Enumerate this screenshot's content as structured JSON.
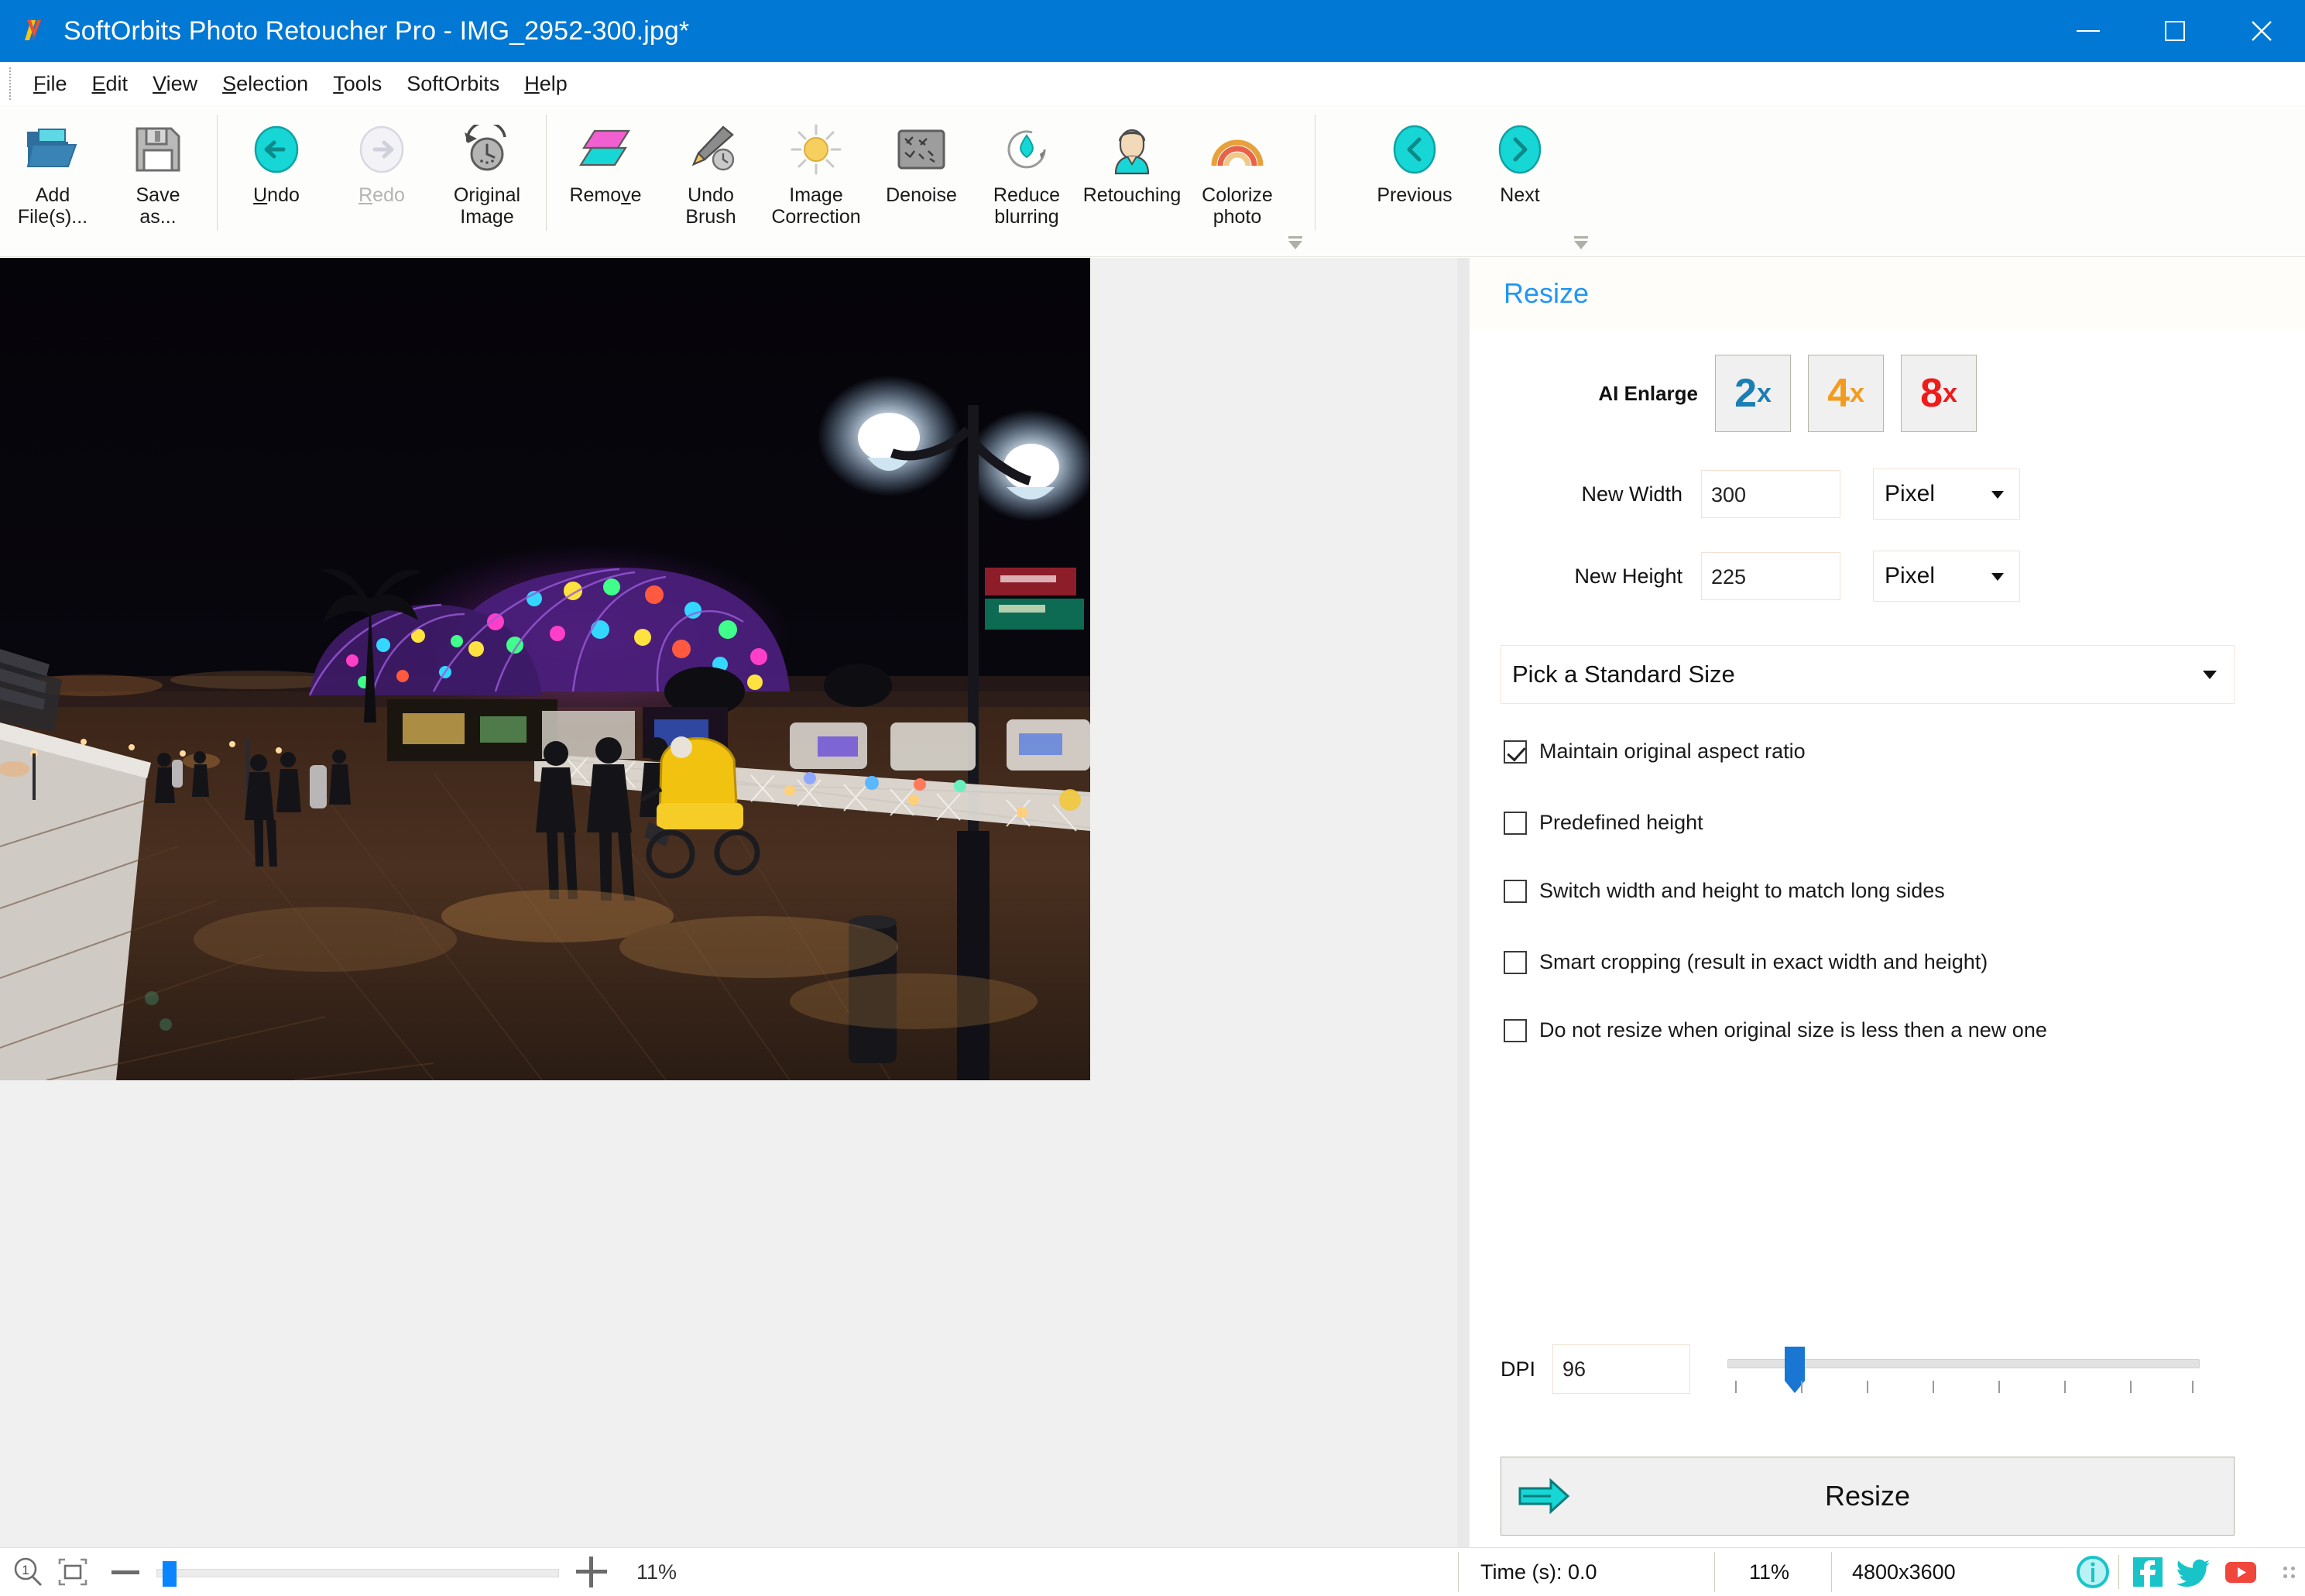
{
  "window": {
    "title": "SoftOrbits Photo Retoucher Pro - IMG_2952-300.jpg*",
    "app_icon": "softorbits-logo-icon",
    "titlebar_color": "#0078d4",
    "controls": {
      "minimize": "minimize-icon",
      "maximize": "maximize-icon",
      "close": "close-icon"
    }
  },
  "menubar": {
    "items": [
      {
        "label": "File",
        "accel": "F"
      },
      {
        "label": "Edit",
        "accel": "E"
      },
      {
        "label": "View",
        "accel": "V"
      },
      {
        "label": "Selection",
        "accel": "S"
      },
      {
        "label": "Tools",
        "accel": "T"
      },
      {
        "label": "SoftOrbits",
        "accel": ""
      },
      {
        "label": "Help",
        "accel": "H"
      }
    ]
  },
  "toolbar": {
    "groups": [
      {
        "name": "file",
        "buttons": [
          {
            "label": "Add\nFile(s)...",
            "icon": "open-folder-icon",
            "disabled": false
          },
          {
            "label": "Save\nas...",
            "icon": "floppy-disk-save-icon",
            "disabled": false
          }
        ]
      },
      {
        "name": "history",
        "buttons": [
          {
            "label": "Undo",
            "icon": "undo-arrow-circle-icon",
            "disabled": false
          },
          {
            "label": "Redo",
            "icon": "redo-arrow-circle-icon",
            "disabled": true
          },
          {
            "label": "Original\nImage",
            "icon": "clock-revert-icon",
            "disabled": false
          }
        ]
      },
      {
        "name": "tools",
        "buttons": [
          {
            "label": "Remove",
            "icon": "eraser-icon",
            "disabled": false
          },
          {
            "label": "Undo\nBrush",
            "icon": "undo-brush-icon",
            "disabled": false
          },
          {
            "label": "Image\nCorrection",
            "icon": "sun-brightness-icon",
            "disabled": false
          },
          {
            "label": "Denoise",
            "icon": "denoise-grain-icon",
            "disabled": false
          },
          {
            "label": "Reduce\nblurring",
            "icon": "droplet-sharpen-icon",
            "disabled": false
          },
          {
            "label": "Retouching",
            "icon": "person-portrait-icon",
            "disabled": false
          },
          {
            "label": "Colorize\nphoto",
            "icon": "rainbow-icon",
            "disabled": false
          }
        ],
        "overflow": "toolbar-overflow-icon"
      },
      {
        "name": "navigation",
        "buttons": [
          {
            "label": "Previous",
            "icon": "chevron-left-circle-icon",
            "disabled": false
          },
          {
            "label": "Next",
            "icon": "chevron-right-circle-icon",
            "disabled": false
          }
        ],
        "overflow": "toolbar-overflow-icon"
      }
    ]
  },
  "canvas": {
    "image_alt": "night-boardwalk-photo",
    "background": "#f0f0f0"
  },
  "panel": {
    "title": "Resize",
    "title_color": "#2196f3",
    "ai_enlarge": {
      "label": "AI Enlarge",
      "options": [
        {
          "label": "2",
          "suffix": "x",
          "color": "#1a7fb5"
        },
        {
          "label": "4",
          "suffix": "x",
          "color": "#f29b1d"
        },
        {
          "label": "8",
          "suffix": "x",
          "color": "#ef1b1b"
        }
      ]
    },
    "new_width": {
      "label": "New Width",
      "value": "300",
      "unit": "Pixel"
    },
    "new_height": {
      "label": "New Height",
      "value": "225",
      "unit": "Pixel"
    },
    "standard_size": {
      "value": "Pick a Standard Size"
    },
    "checkboxes": [
      {
        "label": "Maintain original aspect ratio",
        "checked": true
      },
      {
        "label": "Predefined height",
        "checked": false
      },
      {
        "label": "Switch width and height to match long sides",
        "checked": false
      },
      {
        "label": "Smart cropping (result in exact width and height)",
        "checked": false
      },
      {
        "label": "Do not resize when original size is less then a new one",
        "checked": false
      }
    ],
    "dpi": {
      "label": "DPI",
      "value": "96",
      "slider_position_pct": 12,
      "tick_count": 8
    },
    "action": {
      "label": "Resize",
      "icon": "arrow-right-resize-icon"
    }
  },
  "statusbar": {
    "zoom_one_to_one_icon": "zoom-1to1-icon",
    "fit_to_screen_icon": "fit-to-screen-icon",
    "zoom_out_icon": "zoom-out-icon",
    "zoom_in_icon": "zoom-in-icon",
    "zoom_percent": "11%",
    "time_label": "Time (s): 0.0",
    "zoom_percent_right": "11%",
    "dimensions": "4800x3600",
    "social": [
      {
        "name": "info-icon",
        "color": "#19c4c9"
      },
      {
        "name": "facebook-icon",
        "color": "#19c4c9"
      },
      {
        "name": "twitter-icon",
        "color": "#19c4c9"
      },
      {
        "name": "youtube-icon",
        "color": "#f0463c"
      }
    ]
  }
}
